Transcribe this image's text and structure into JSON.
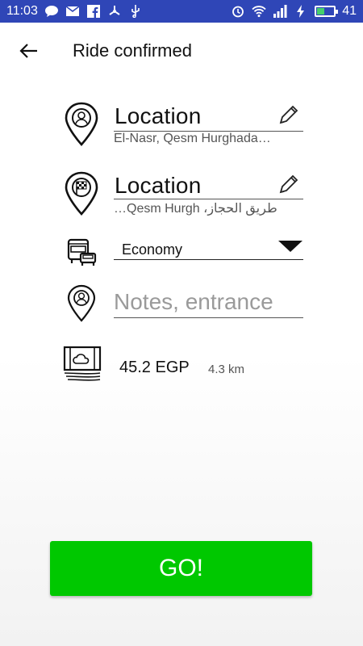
{
  "status_bar": {
    "time": "11:03",
    "battery": "41",
    "icons": [
      "chat-icon",
      "mail-icon",
      "facebook-icon",
      "fan-icon",
      "usb-icon",
      "alarm-icon",
      "wifi-icon",
      "signal-icon",
      "charging-icon",
      "battery-icon"
    ]
  },
  "appbar": {
    "title": "Ride confirmed",
    "back_icon": "arrow-left-icon"
  },
  "pickup": {
    "label": "Location",
    "address": "El-Nasr, Qesm Hurghada…",
    "icon": "pin-person-icon",
    "edit_icon": "pencil-icon"
  },
  "dropoff": {
    "label": "Location",
    "address": "طريق الحجاز، Qesm Hurgh…",
    "icon": "pin-checkered-flag-icon",
    "edit_icon": "pencil-icon"
  },
  "vehicle": {
    "selected": "Economy",
    "icon": "bus-car-icon"
  },
  "notes": {
    "placeholder": "Notes, entrance",
    "value": "",
    "icon": "pin-person-icon"
  },
  "fare": {
    "price": "45.2 EGP",
    "distance": "4.3 km",
    "icon": "money-icon"
  },
  "go_button": {
    "label": "GO!",
    "color": "#00c800"
  },
  "colors": {
    "status_bar": "#2f46b7",
    "accent": "#00c800"
  }
}
